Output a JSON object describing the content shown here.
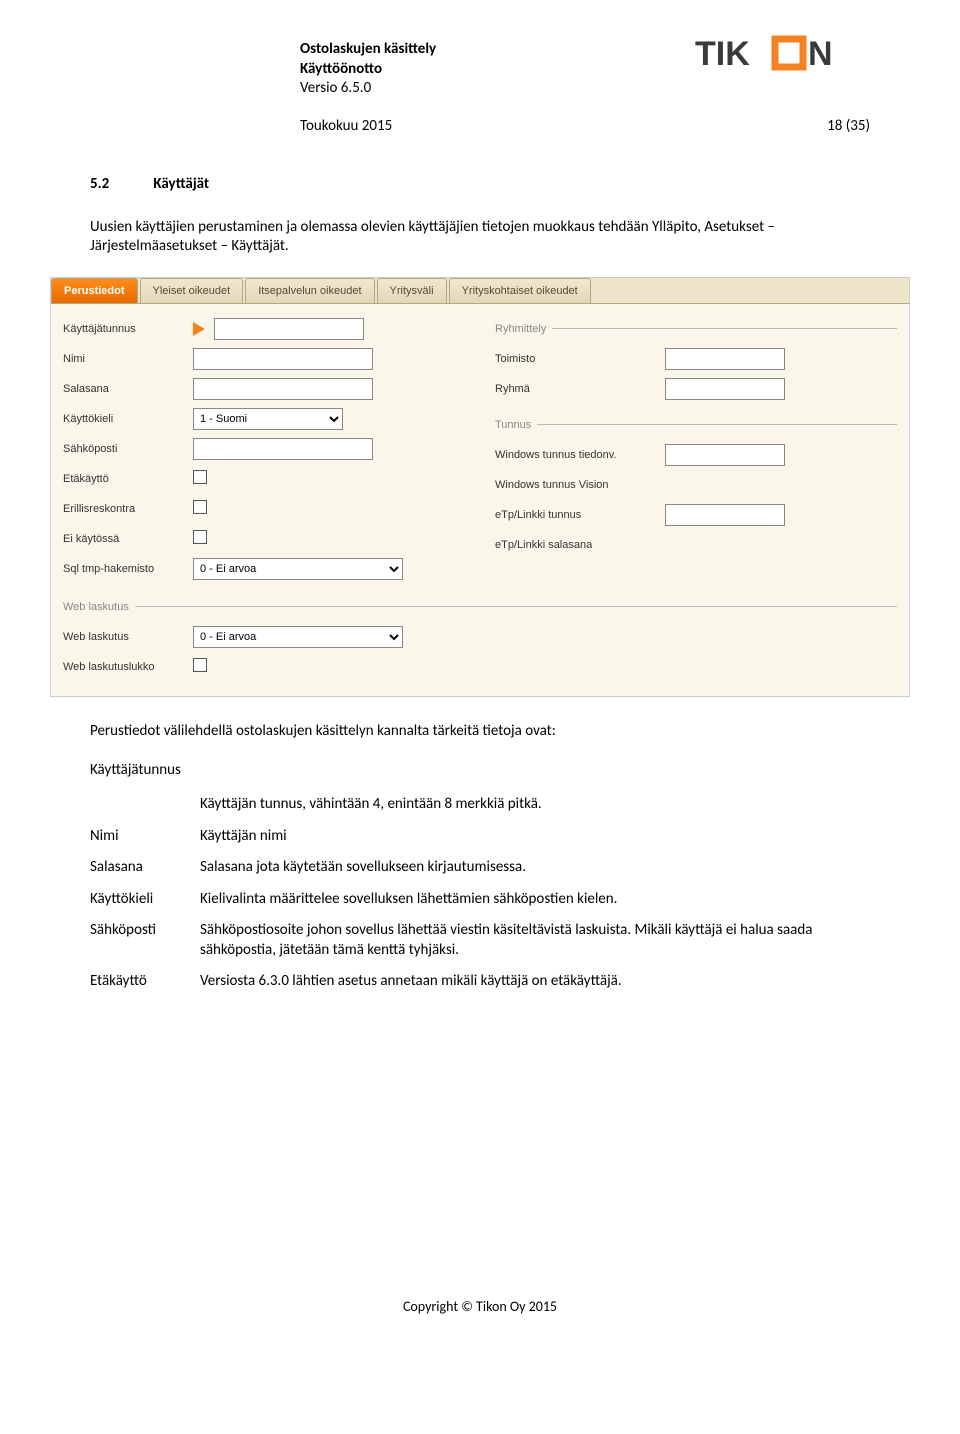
{
  "header": {
    "title1": "Ostolaskujen käsittely",
    "title2": "Käyttöönotto",
    "version": "Versio 6.5.0",
    "date": "Toukokuu 2015",
    "page": "18 (35)",
    "logo_text": "TIKON"
  },
  "section": {
    "number": "5.2",
    "title": "Käyttäjät"
  },
  "intro": "Uusien käyttäjien perustaminen ja olemassa olevien käyttäjäjien tietojen muokkaus tehdään Ylläpito, Asetukset – Järjestelmäasetukset – Käyttäjät.",
  "app": {
    "tabs": [
      "Perustiedot",
      "Yleiset oikeudet",
      "Itsepalvelun oikeudet",
      "Yritysväli",
      "Yrityskohtaiset oikeudet"
    ],
    "left_fields": {
      "kayttajatunnus_lbl": "Käyttäjätunnus",
      "nimi_lbl": "Nimi",
      "salasana_lbl": "Salasana",
      "kayttokieli_lbl": "Käyttökieli",
      "kayttokieli_val": "1 - Suomi",
      "sahkoposti_lbl": "Sähköposti",
      "etakaytto_lbl": "Etäkäyttö",
      "erillisreskontra_lbl": "Erillisreskontra",
      "ei_kaytossa_lbl": "Ei käytössä",
      "sql_tmp_lbl": "Sql tmp-hakemisto",
      "sql_tmp_val": "0  -  Ei arvoa"
    },
    "right_groups": {
      "ryhmittely_title": "Ryhmittely",
      "toimisto_lbl": "Toimisto",
      "ryhma_lbl": "Ryhmä",
      "tunnus_title": "Tunnus",
      "win_tiedonv_lbl": "Windows tunnus tiedonv.",
      "win_vision_lbl": "Windows tunnus Vision",
      "etp_tunnus_lbl": "eTp/Linkki tunnus",
      "etp_salasana_lbl": "eTp/Linkki salasana"
    },
    "webgroup": {
      "title": "Web laskutus",
      "web_laskutus_lbl": "Web laskutus",
      "web_laskutus_val": "0  -  Ei arvoa",
      "web_lukko_lbl": "Web laskutuslukko"
    }
  },
  "after_image": "Perustiedot välilehdellä ostolaskujen käsittelyn kannalta tärkeitä tietoja ovat:",
  "defs_heading": "Käyttäjätunnus",
  "defs_first_desc": "Käyttäjän tunnus, vähintään 4, enintään 8 merkkiä pitkä.",
  "defs": [
    {
      "term": "Nimi",
      "desc": "Käyttäjän nimi"
    },
    {
      "term": "Salasana",
      "desc": "Salasana jota käytetään sovellukseen kirjautumisessa."
    },
    {
      "term": "Käyttökieli",
      "desc": "Kielivalinta määrittelee sovelluksen lähettämien sähköpostien kielen."
    },
    {
      "term": "Sähköposti",
      "desc": "Sähköpostiosoite johon sovellus lähettää viestin käsiteltävistä laskuista. Mikäli käyttäjä ei halua saada sähköpostia, jätetään tämä kenttä tyhjäksi."
    },
    {
      "term": "Etäkäyttö",
      "desc": "Versiosta 6.3.0 lähtien asetus annetaan mikäli käyttäjä on etäkäyttäjä."
    }
  ],
  "footer": "Copyright © Tikon Oy 2015"
}
